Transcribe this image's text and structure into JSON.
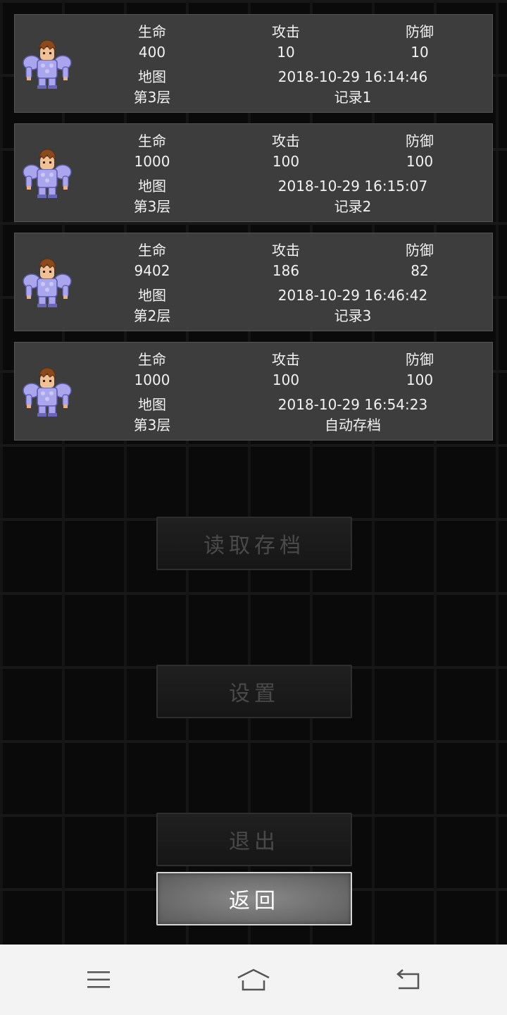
{
  "labels": {
    "hp": "生命",
    "atk": "攻击",
    "def": "防御",
    "map": "地图"
  },
  "slots": [
    {
      "hp": "400",
      "atk": "10",
      "def": "10",
      "datetime": "2018-10-29 16:14:46",
      "floor": "第3层",
      "name": "记录1"
    },
    {
      "hp": "1000",
      "atk": "100",
      "def": "100",
      "datetime": "2018-10-29 16:15:07",
      "floor": "第3层",
      "name": "记录2"
    },
    {
      "hp": "9402",
      "atk": "186",
      "def": "82",
      "datetime": "2018-10-29 16:46:42",
      "floor": "第2层",
      "name": "记录3"
    },
    {
      "hp": "1000",
      "atk": "100",
      "def": "100",
      "datetime": "2018-10-29 16:54:23",
      "floor": "第3层",
      "name": "自动存档"
    }
  ],
  "menu": {
    "load_label": "读取存档",
    "settings_label": "设置",
    "exit_label": "退出",
    "back_label": "返回"
  },
  "navbar": {
    "menu_icon": "menu-icon",
    "home_icon": "home-icon",
    "back_icon": "back-icon"
  },
  "colors": {
    "slot_bg": "#3d3d3d",
    "text": "#f2f2f2",
    "hero_armor": "#a9a6ee",
    "hero_hair": "#8a4a1e"
  }
}
